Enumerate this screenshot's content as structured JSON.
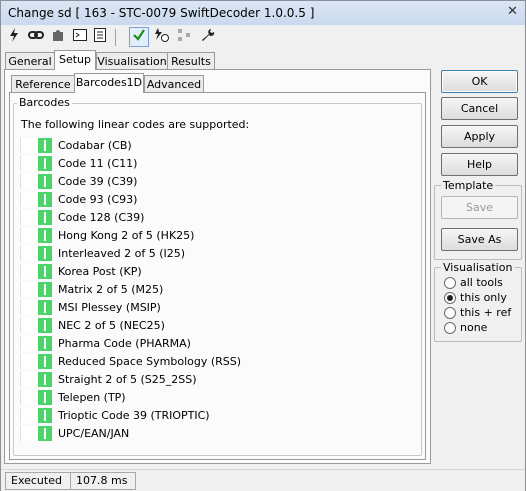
{
  "window": {
    "title": "Change sd [ 163 - STC-0079 SwiftDecoder 1.0.0.5 ]",
    "close_glyph": "✕"
  },
  "toolbar": {
    "icons": [
      "lightning-icon",
      "link-icon",
      "puzzle-icon",
      "console-icon",
      "document-icon",
      "check-icon",
      "timer-icon",
      "network-icon",
      "wrench-icon"
    ]
  },
  "tabs": [
    "General",
    "Setup",
    "Visualisation",
    "Results"
  ],
  "subtabs": [
    "Reference",
    "Barcodes1D",
    "Advanced"
  ],
  "barcodes": {
    "group_title": "Barcodes",
    "intro": "The following linear codes are supported:",
    "items": [
      "Codabar (CB)",
      "Code 11 (C11)",
      "Code 39 (C39)",
      "Code 93 (C93)",
      "Code 128 (C39)",
      "Hong Kong 2 of 5 (HK25)",
      "Interleaved 2 of 5 (I25)",
      "Korea Post (KP)",
      "Matrix 2 of 5 (M25)",
      "MSI Plessey (MSIP)",
      "NEC 2 of 5 (NEC25)",
      "Pharma Code (PHARMA)",
      "Reduced Space Symbology (RSS)",
      "Straight 2 of 5 (S25_2SS)",
      "Telepen (TP)",
      "Trioptic Code 39 (TRIOPTIC)",
      "UPC/EAN/JAN"
    ]
  },
  "buttons": {
    "ok": "OK",
    "cancel": "Cancel",
    "apply": "Apply",
    "help": "Help"
  },
  "template": {
    "title": "Template",
    "save": "Save",
    "save_as": "Save As"
  },
  "visualisation": {
    "title": "Visualisation",
    "options": [
      "all tools",
      "this only",
      "this + ref",
      "none"
    ],
    "selected": "this only"
  },
  "status": {
    "state": "Executed",
    "time": "107.8 ms"
  }
}
